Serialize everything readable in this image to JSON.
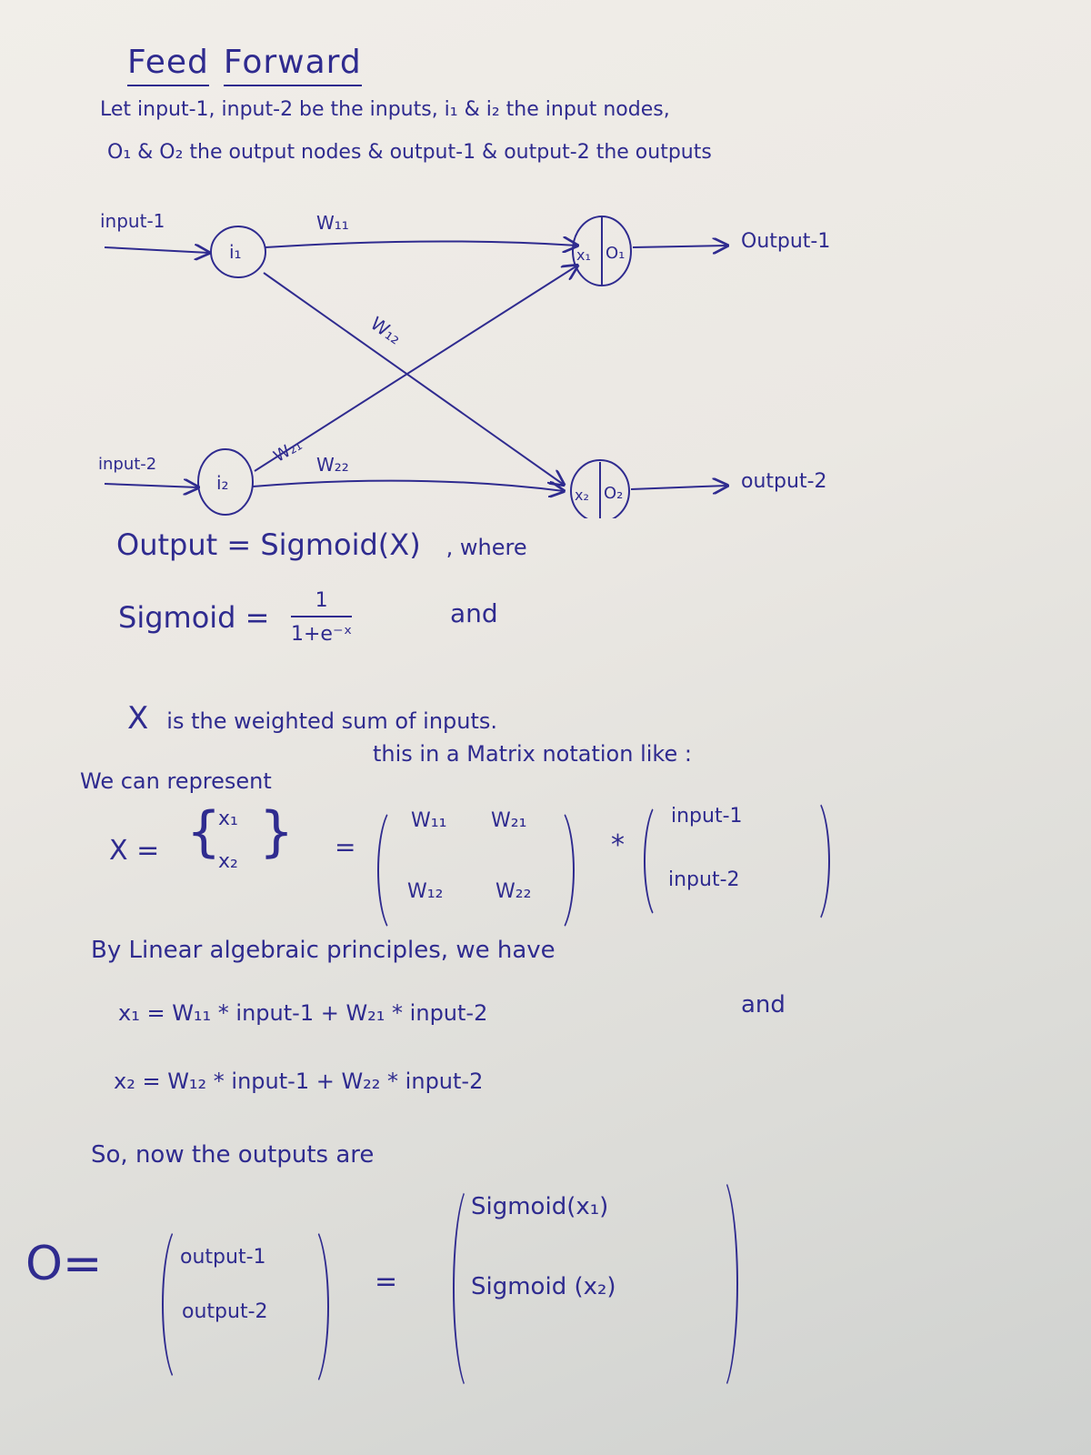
{
  "title": {
    "word1": "Feed",
    "word2": "Forward"
  },
  "intro": {
    "line1": "Let input-1, input-2 be the inputs, i₁ & i₂ the input nodes,",
    "line2": "O₁ & O₂ the output nodes & output-1 & output-2 the outputs"
  },
  "diagram": {
    "input_labels": [
      "input-1",
      "input-2"
    ],
    "input_nodes": [
      "i₁",
      "i₂"
    ],
    "output_nodes": [
      {
        "sum": "x₁",
        "out": "O₁"
      },
      {
        "sum": "x₂",
        "out": "O₂"
      }
    ],
    "output_labels": [
      "Output-1",
      "output-2"
    ],
    "weights": {
      "w11": "W₁₁",
      "w12": "W₁₂",
      "w21": "W₂₁",
      "w22": "W₂₂"
    }
  },
  "sigmoid_section": {
    "output_eq": "Output = Sigmoid(X)",
    "where": ", where",
    "sigmoid_lhs": "Sigmoid =",
    "numerator": "1",
    "denominator": "1+e⁻ˣ",
    "and": "and",
    "x_symbol": "X",
    "x_desc": "is the weighted sum of inputs."
  },
  "matrix_section": {
    "intro_a": "We can represent",
    "intro_b": "this in a Matrix notation like :",
    "lhs": "X =",
    "vector": [
      "x₁",
      "x₂"
    ],
    "equals": "=",
    "weight_matrix": [
      [
        "W₁₁",
        "W₂₁"
      ],
      [
        "W₁₂",
        "W₂₂"
      ]
    ],
    "multiply": "*",
    "input_vector": [
      "input-1",
      "input-2"
    ]
  },
  "algebra": {
    "intro": "By Linear algebraic principles, we have",
    "x1": "x₁ = W₁₁ * input-1 + W₂₁ * input-2",
    "and": "and",
    "x2": "x₂ = W₁₂ * input-1 + W₂₂ * input-2"
  },
  "outputs": {
    "intro": "So, now the outputs are",
    "lhs": "O=",
    "vector": [
      "output-1",
      "output-2"
    ],
    "equals": "=",
    "sigmoid_vector": [
      "Sigmoid(x₁)",
      "Sigmoid (x₂)"
    ]
  },
  "colors": {
    "ink": "#2f2b8f",
    "paper": "#eeebe6"
  }
}
